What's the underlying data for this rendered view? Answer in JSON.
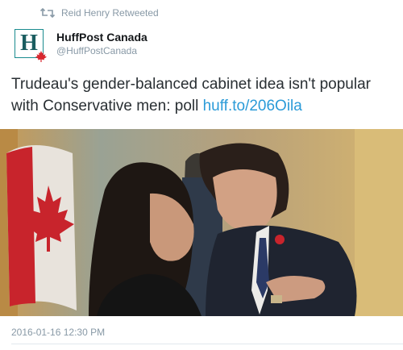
{
  "retweet": {
    "text": "Reid Henry Retweeted",
    "icon": "retweet-icon"
  },
  "author": {
    "display_name": "HuffPost Canada",
    "handle": "@HuffPostCanada",
    "avatar_letter": "H",
    "avatar_color": "#1a8b8f"
  },
  "tweet": {
    "text": "Trudeau's gender-balanced cabinet idea isn't popular with Conservative men: poll ",
    "link": "huff.to/206Oila",
    "link_color": "#2b9bd8"
  },
  "timestamp": "2016-01-16 12:30 PM"
}
